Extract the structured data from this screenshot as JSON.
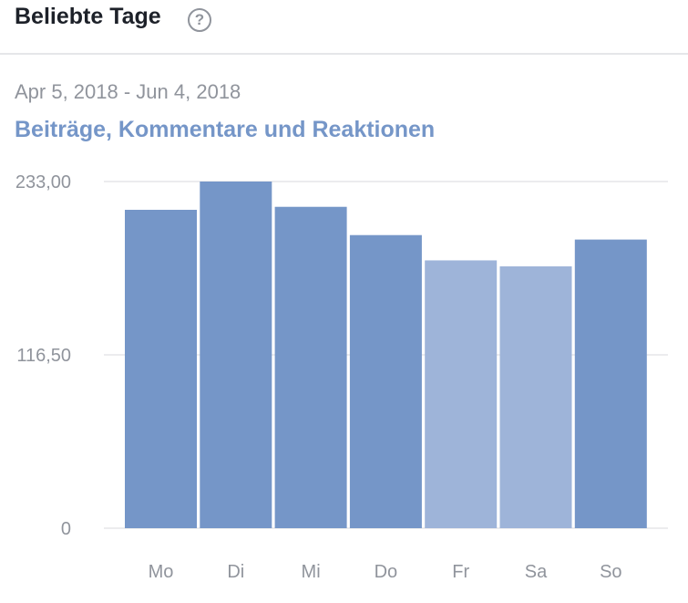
{
  "header": {
    "title": "Beliebte Tage",
    "help_icon": "question-circle-icon"
  },
  "date_range": "Apr 5, 2018 - Jun 4, 2018",
  "chart_data": {
    "type": "bar",
    "title": "Beiträge, Kommentare und Reaktionen",
    "categories": [
      "Mo",
      "Di",
      "Mi",
      "Do",
      "Fr",
      "Sa",
      "So"
    ],
    "values": [
      214,
      233,
      216,
      197,
      180,
      176,
      194
    ],
    "ylim": [
      0,
      233
    ],
    "yticks": [
      0,
      116.5,
      233
    ],
    "ytick_labels": [
      "0",
      "116,50",
      "233,00"
    ],
    "grid": true,
    "colors": {
      "bar": "#7596c8",
      "bar_light": "#9eb4d9",
      "grid": "#e5e6e9"
    },
    "light_categories": [
      "Fr",
      "Sa"
    ]
  }
}
